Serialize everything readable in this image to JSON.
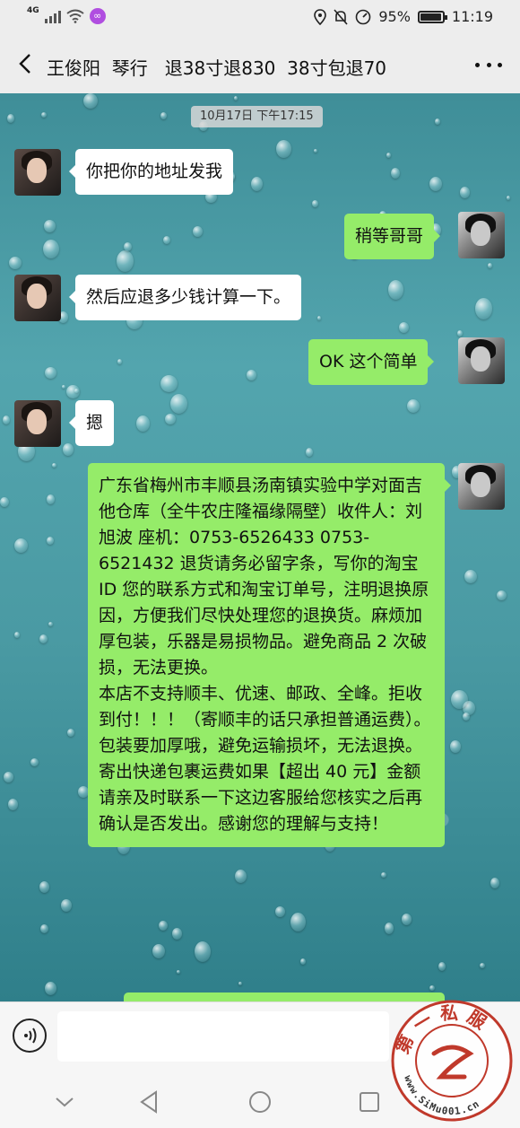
{
  "status_bar": {
    "network": "4G",
    "battery": "95%",
    "battery_level": 0.95,
    "time": "11:19",
    "app_icon": "infinity-icon"
  },
  "header": {
    "back_icon": "chevron-left-icon",
    "title": "王俊阳  琴行   退38寸退830  38寸包退70",
    "more_icon": "more-dots-icon"
  },
  "chat": {
    "timestamp": "10月17日 下午17:15",
    "messages": [
      {
        "side": "left",
        "text": "你把你的地址发我"
      },
      {
        "side": "right",
        "text": "稍等哥哥"
      },
      {
        "side": "left",
        "text": "然后应退多少钱计算一下。"
      },
      {
        "side": "right",
        "text": "OK  这个简单"
      },
      {
        "side": "left",
        "text": "摁"
      },
      {
        "side": "right",
        "text": "广东省梅州市丰顺县汤南镇实验中学对面吉他仓库（全牛农庄隆福缘隔壁）收件人：刘旭波 座机：0753-6526433 0753-6521432 退货请务必留字条，写你的淘宝 ID 您的联系方式和淘宝订单号，注明退换原因，方便我们尽快处理您的退换货。麻烦加厚包装，乐器是易损物品。避免商品 2 次破损，无法更换。\n本店不支持顺丰、优速、邮政、全峰。拒收到付！！！（寄顺丰的话只承担普通运费）。包装要加厚哦，避免运输损坏，无法退换。\n寄出快递包裹运费如果【超出 40 元】金额请亲及时联系一下这边客服给您核实之后再确认是否发出。感谢您的理解与支持！"
      }
    ]
  },
  "input_bar": {
    "voice_icon": "voice-icon",
    "input_value": ""
  },
  "nav_bar": {
    "icons": [
      "chevron-down-icon",
      "back-triangle-icon",
      "home-circle-icon",
      "recents-square-icon"
    ]
  },
  "watermark": {
    "top_text": "第一私服",
    "bottom_text": "www.SiMu001.cn"
  },
  "colors": {
    "header_bg": "#ededed",
    "bubble_green": "#95ec69",
    "bubble_white": "#ffffff",
    "watermark_red": "#c0392b"
  }
}
